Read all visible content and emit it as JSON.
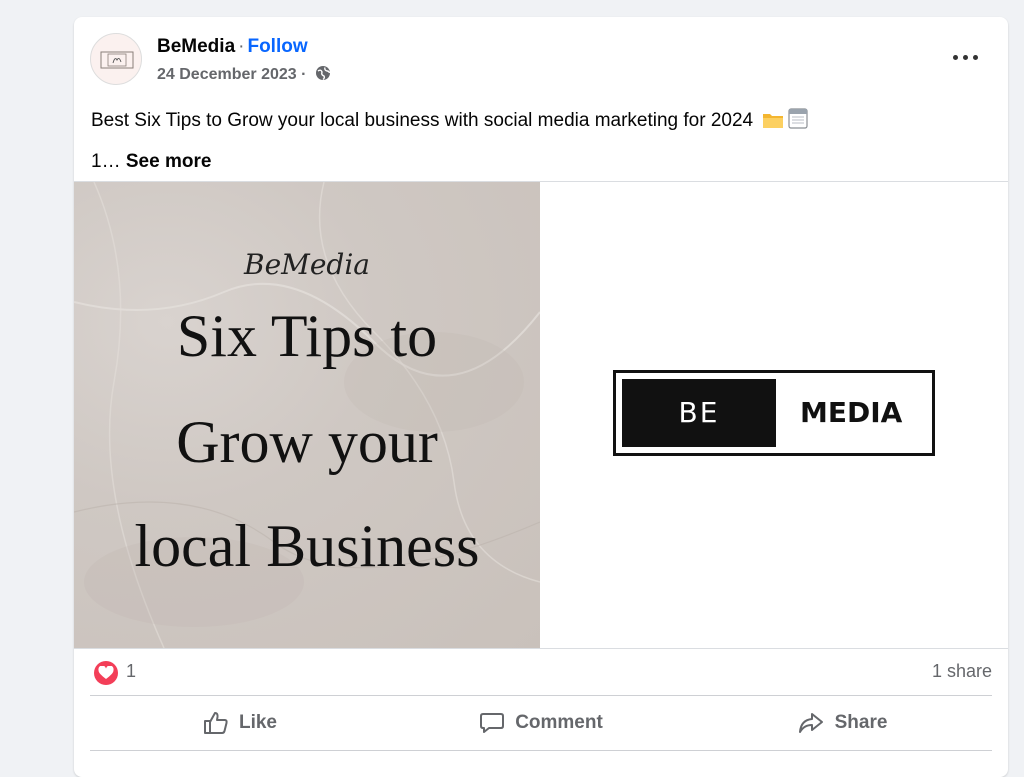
{
  "post": {
    "author": "BeMedia",
    "separator": "·",
    "follow_label": "Follow",
    "date": "24 December 2023",
    "date_separator": "·",
    "audience_icon": "globe-icon",
    "more_icon": "more-options-icon",
    "caption_line1": "Best Six Tips to Grow your local business with social media marketing for 2024",
    "caption_line2": "1…",
    "see_more_label": "See more",
    "caption_emojis": [
      "folder-emoji",
      "calendar-emoji"
    ]
  },
  "media": {
    "left": {
      "script_brand": "BeMedia",
      "line1": "Six Tips to",
      "line2": "Grow your",
      "line3": "local Business"
    },
    "right": {
      "logo_left": "BE",
      "logo_right": "MEDIA"
    }
  },
  "stats": {
    "reaction_icon": "love-reaction-icon",
    "reaction_count": "1",
    "shares": "1 share"
  },
  "actions": {
    "like_label": "Like",
    "comment_label": "Comment",
    "share_label": "Share"
  },
  "colors": {
    "accent": "#0866ff",
    "heart": "#f33e58",
    "muted_text": "#65676b",
    "background": "#f0f2f5"
  }
}
